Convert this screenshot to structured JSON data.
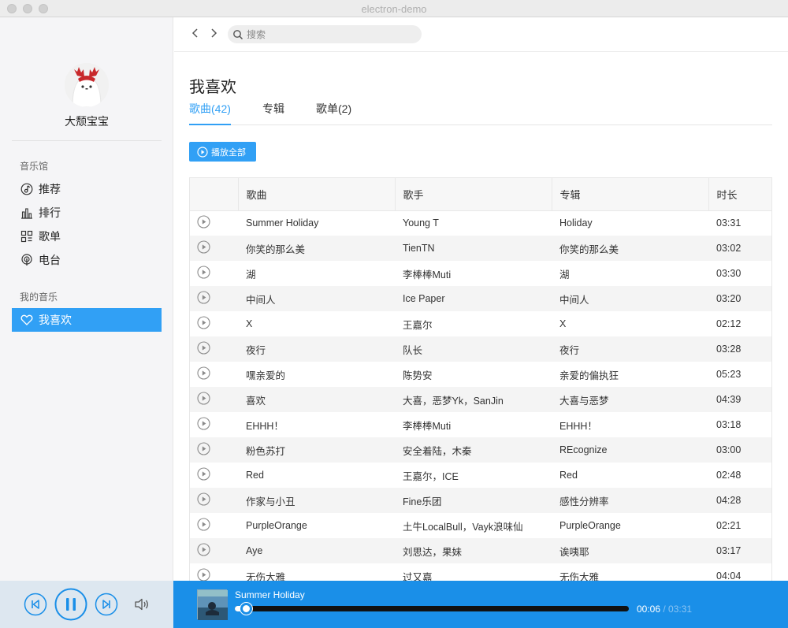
{
  "window": {
    "title": "electron-demo"
  },
  "sidebar": {
    "username": "大颓宝宝",
    "section_music_hall": "音乐馆",
    "section_my_music": "我的音乐",
    "items": [
      {
        "label": "推荐",
        "icon": "music-note-icon"
      },
      {
        "label": "排行",
        "icon": "bar-chart-icon"
      },
      {
        "label": "歌单",
        "icon": "playlist-grid-icon"
      },
      {
        "label": "电台",
        "icon": "radio-icon"
      },
      {
        "label": "我喜欢",
        "icon": "heart-icon",
        "active": true
      }
    ]
  },
  "topbar": {
    "back": "<",
    "forward": ">",
    "search_placeholder": "搜索"
  },
  "page": {
    "title": "我喜欢",
    "tabs": [
      {
        "label": "歌曲(42)",
        "active": true
      },
      {
        "label": "专辑"
      },
      {
        "label": "歌单(2)"
      }
    ],
    "play_all_label": "播放全部"
  },
  "table": {
    "headers": [
      "",
      "歌曲",
      "歌手",
      "专辑",
      "时长"
    ],
    "rows": [
      {
        "song": "Summer Holiday",
        "artist": "Young T",
        "album": "Holiday",
        "duration": "03:31"
      },
      {
        "song": "你笑的那么美",
        "artist": "TienTN",
        "album": "你笑的那么美",
        "duration": "03:02"
      },
      {
        "song": "湖",
        "artist": "李棒棒Muti",
        "album": "湖",
        "duration": "03:30"
      },
      {
        "song": "中间人",
        "artist": "Ice Paper",
        "album": "中间人",
        "duration": "03:20"
      },
      {
        "song": "X",
        "artist": "王嘉尔",
        "album": "X",
        "duration": "02:12"
      },
      {
        "song": "夜行",
        "artist": "队长",
        "album": "夜行",
        "duration": "03:28"
      },
      {
        "song": "嘿亲爱的",
        "artist": "陈势安",
        "album": "亲爱的偏执狂",
        "duration": "05:23"
      },
      {
        "song": "喜欢",
        "artist": "大喜，恶梦Yk，SanJin",
        "album": "大喜与恶梦",
        "duration": "04:39"
      },
      {
        "song": "EHHH！",
        "artist": "李棒棒Muti",
        "album": "EHHH！",
        "duration": "03:18"
      },
      {
        "song": "粉色苏打",
        "artist": "安全着陆，木秦",
        "album": "REcognize",
        "duration": "03:00"
      },
      {
        "song": "Red",
        "artist": "王嘉尔，ICE",
        "album": "Red",
        "duration": "02:48"
      },
      {
        "song": "作家与小丑",
        "artist": "Fine乐团",
        "album": "感性分辨率",
        "duration": "04:28"
      },
      {
        "song": "PurpleOrange",
        "artist": "土牛LocalBull，Vayk浪味仙",
        "album": "PurpleOrange",
        "duration": "02:21"
      },
      {
        "song": "Aye",
        "artist": "刘思达，果妹",
        "album": "诶咦耶",
        "duration": "03:17"
      },
      {
        "song": "无伤大雅",
        "artist": "过又嘉",
        "album": "无伤大雅",
        "duration": "04:04"
      }
    ]
  },
  "player": {
    "title": "Summer Holiday",
    "current_time": "00:06",
    "separator": " / ",
    "total_time": "03:31",
    "progress": 0.028
  },
  "colors": {
    "accent": "#31a0f5",
    "player_bg": "#1a8fe8"
  }
}
